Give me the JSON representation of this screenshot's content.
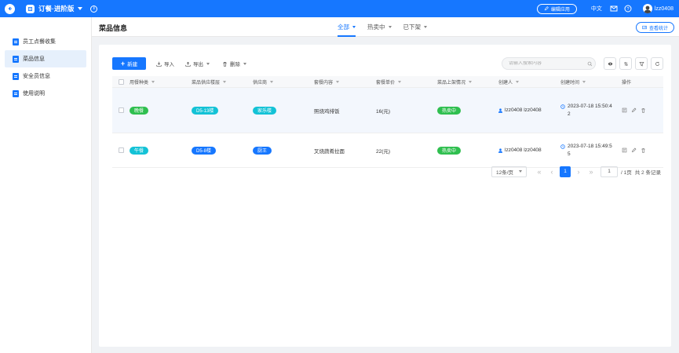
{
  "topbar": {
    "app_title": "订餐·进阶版",
    "edit_app_label": "编辑应用",
    "language": "中文",
    "username": "lzz0408",
    "accent_color": "#1677ff"
  },
  "sidebar": {
    "items": [
      {
        "label": "员工点餐收集",
        "icon": "form-icon",
        "active": false
      },
      {
        "label": "菜品信息",
        "icon": "form-icon",
        "active": true
      },
      {
        "label": "安全员信息",
        "icon": "form-icon",
        "active": false
      },
      {
        "label": "使用说明",
        "icon": "form-icon",
        "active": false
      }
    ]
  },
  "header": {
    "title": "菜品信息",
    "tabs": [
      {
        "label": "全部",
        "active": true
      },
      {
        "label": "热卖中",
        "active": false
      },
      {
        "label": "已下架",
        "active": false
      }
    ],
    "stats_label": "查看统计"
  },
  "toolbar": {
    "new_label": "新建",
    "import_label": "导入",
    "export_label": "导出",
    "delete_label": "删除",
    "search_placeholder": "请输入搜索内容"
  },
  "table": {
    "columns": [
      "用餐种类",
      "菜品供应楼层",
      "供应商",
      "套餐内容",
      "套餐单价",
      "菜品上架情况",
      "创建人",
      "创建时间",
      "操作"
    ],
    "rows": [
      {
        "meal_type": "晚餐",
        "meal_color": "#2fbf4f",
        "floor": "D5-13楼",
        "floor_color": "#13c2d6",
        "supplier": "家乐楼",
        "supplier_color": "#13c2d6",
        "content": "照烧鸡排饭",
        "price": "16(元)",
        "status": "热卖中",
        "status_color": "#2fbf4f",
        "creator": "lzz0408 lzz0408",
        "time_line1": "2023-07-18 15:50:4",
        "time_line2": "2"
      },
      {
        "meal_type": "午餐",
        "meal_color": "#13c2d6",
        "floor": "D5-8楼",
        "floor_color": "#1677ff",
        "supplier": "厨王",
        "supplier_color": "#1677ff",
        "content": "叉烧蔬肴拉面",
        "price": "22(元)",
        "status": "热卖中",
        "status_color": "#2fbf4f",
        "creator": "lzz0408 lzz0408",
        "time_line1": "2023-07-18 15:49:5",
        "time_line2": "5"
      }
    ]
  },
  "pagination": {
    "page_size": "12条/页",
    "current_page": "1",
    "jump_value": "1",
    "total_pages": "/ 1页",
    "total_records": "共 2 条记录"
  }
}
